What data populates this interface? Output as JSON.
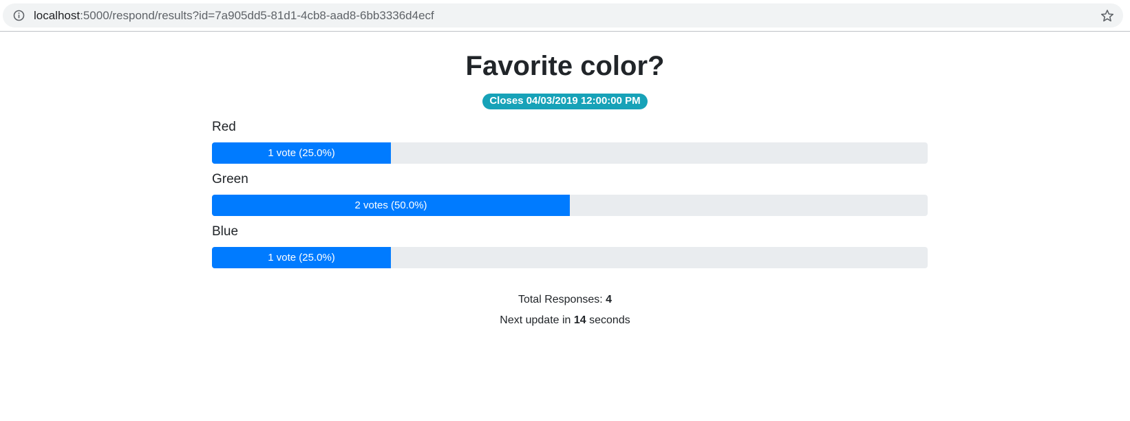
{
  "browser": {
    "url_host": "localhost",
    "url_rest": ":5000/respond/results?id=7a905dd5-81d1-4cb8-aad8-6bb3336d4ecf",
    "info_icon": "info-icon",
    "bookmark_icon": "star-icon"
  },
  "poll": {
    "title": "Favorite color?",
    "closes_badge": "Closes 04/03/2019 12:00:00 PM",
    "options": [
      {
        "label": "Red",
        "bar_text": "1 vote (25.0%)",
        "percent": 25.0
      },
      {
        "label": "Green",
        "bar_text": "2 votes (50.0%)",
        "percent": 50.0
      },
      {
        "label": "Blue",
        "bar_text": "1 vote (25.0%)",
        "percent": 25.0
      }
    ],
    "total_label": "Total Responses: ",
    "total_value": "4",
    "update_prefix": "Next update in ",
    "update_value": "14",
    "update_suffix": " seconds"
  },
  "colors": {
    "bar_fill": "#007bff",
    "bar_track": "#e9ecef",
    "badge": "#17a2b8"
  }
}
